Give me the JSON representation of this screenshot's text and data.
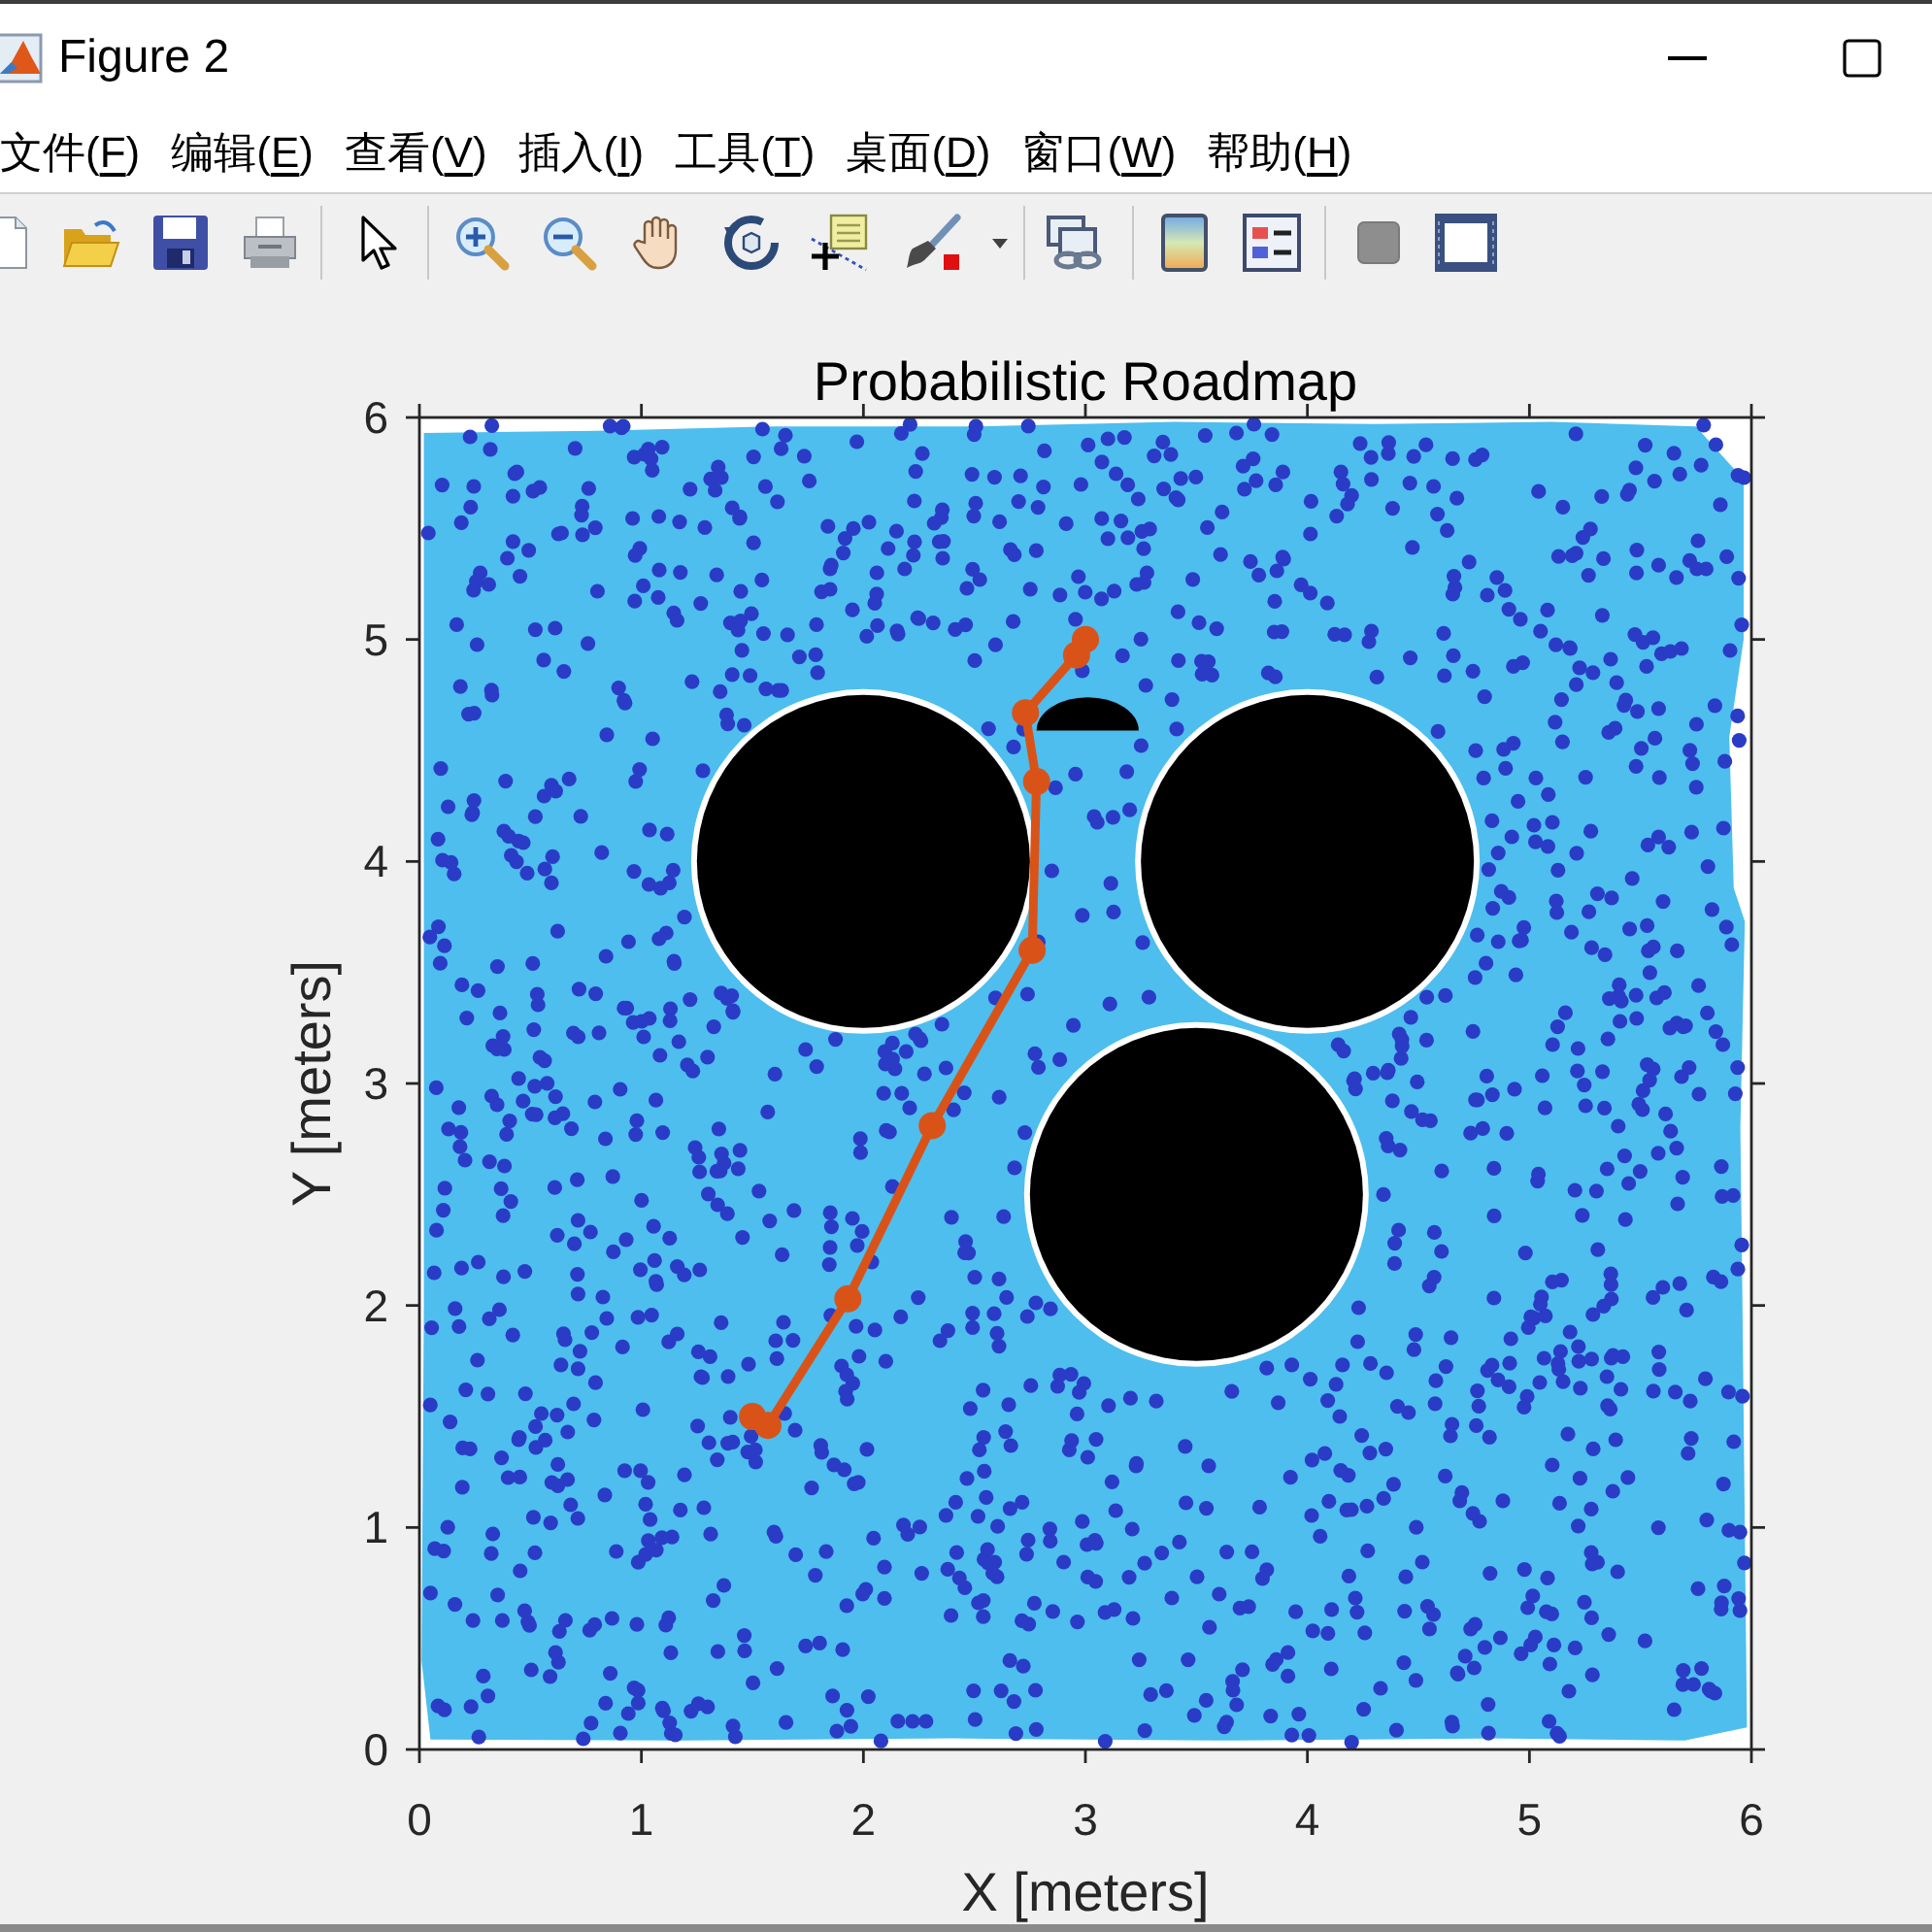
{
  "window": {
    "title": "Figure 2"
  },
  "menu_bar": [
    {
      "text_before": "文件(",
      "access_key": "F",
      "text_after": ")"
    },
    {
      "text_before": "编辑(",
      "access_key": "E",
      "text_after": ")"
    },
    {
      "text_before": "查看(",
      "access_key": "V",
      "text_after": ")"
    },
    {
      "text_before": "插入(",
      "access_key": "I",
      "text_after": ")"
    },
    {
      "text_before": "工具(",
      "access_key": "T",
      "text_after": ")"
    },
    {
      "text_before": "桌面(",
      "access_key": "D",
      "text_after": ")"
    },
    {
      "text_before": "窗口(",
      "access_key": "W",
      "text_after": ")"
    },
    {
      "text_before": "帮助(",
      "access_key": "H",
      "text_after": ")"
    }
  ],
  "figure": {
    "chart_data": {
      "type": "line",
      "title": "Probabilistic Roadmap",
      "xlabel": "X [meters]",
      "ylabel": "Y [meters]",
      "x": [
        1.5,
        1.57,
        1.93,
        2.31,
        2.76,
        2.78,
        2.73,
        2.96,
        3.0
      ],
      "series": [
        {
          "color": "#d95319",
          "marker": "o",
          "values": [
            1.5,
            1.46,
            2.03,
            2.81,
            3.6,
            4.36,
            4.67,
            4.93,
            5.0
          ]
        }
      ],
      "xlim": [
        0,
        6
      ],
      "ylim": [
        0,
        6
      ],
      "xticks": [
        0,
        1,
        2,
        3,
        4,
        5,
        6
      ],
      "yticks": [
        0,
        1,
        2,
        3,
        4,
        5,
        6
      ]
    }
  }
}
